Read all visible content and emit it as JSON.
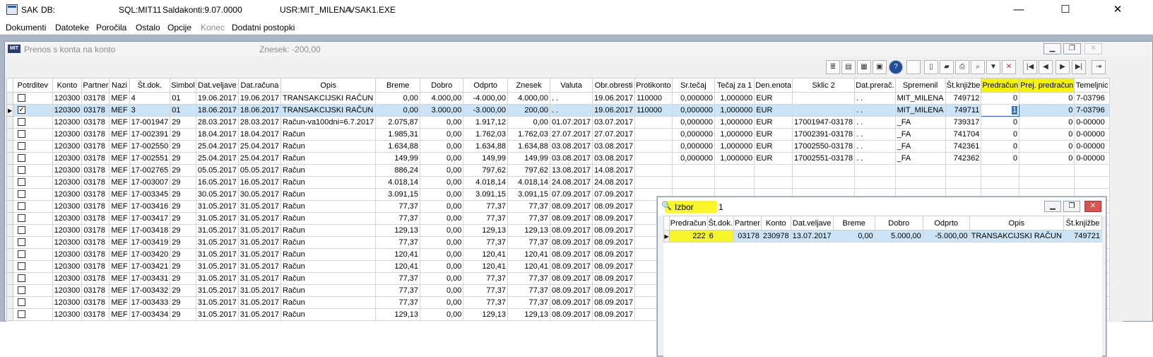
{
  "window": {
    "app": "SAK",
    "db_label": "DB:",
    "sql": "SQL:MIT11",
    "saldakonti": "Saldakonti:9.07.0000",
    "usr": "USR:MIT_MILENA",
    "exe": "VSAK1.EXE",
    "minimize": "—",
    "maximize": "☐",
    "close": "✕"
  },
  "menu": [
    "Dokumenti",
    "Datoteke",
    "Poročila",
    "Ostalo",
    "Opcije",
    "Konec",
    "Dodatni postopki"
  ],
  "child": {
    "logo": "MIT",
    "title": "Prenos s konta na konto",
    "znesek": "Znesek: -200,00"
  },
  "toolbar_icons": [
    "notes-icon",
    "folder-icon",
    "print-preview-icon",
    "monitor-icon",
    "help-icon",
    "blank-icon",
    "new-icon",
    "open-icon",
    "print-icon",
    "search-icon",
    "filter-icon",
    "delete-icon",
    "first-icon",
    "prev-icon",
    "next-icon",
    "last-icon",
    "exit-icon"
  ],
  "main_grid": {
    "columns": [
      "",
      "Potrditev",
      "Konto",
      "Partner",
      "Nazi",
      "Št.dok.",
      "Simbol",
      "Dat.veljave",
      "Dat.računa",
      "Opis",
      "Breme",
      "Dobro",
      "Odprto",
      "Znesek",
      "Valuta",
      "Obr.obresti",
      "Protikonto",
      "Sr.tečaj",
      "Tečaj za 1",
      "Den.enota",
      "Sklic 2",
      "Dat.prerač.",
      "Spremenil",
      "Št.knjižbe",
      "Predračun",
      "Prej. predračun",
      "Temeljnic"
    ],
    "rows": [
      {
        "ind": "",
        "chk": "",
        "c": [
          "120300",
          "03178",
          "MEF",
          "4",
          "01",
          "19.06.2017",
          "19.06.2017",
          "TRANSAKCIJSKI RAČUN",
          "0,00",
          "4.000,00",
          "-4.000,00",
          "4.000,00",
          ". .",
          "19.06.2017",
          "110000",
          "0,000000",
          "1,000000",
          "EUR",
          "",
          ". .",
          "MIT_MILENA",
          "749712",
          "0",
          "0",
          "7-03796"
        ]
      },
      {
        "ind": "▶",
        "chk": "✓",
        "c": [
          "120300",
          "03178",
          "MEF",
          "3",
          "01",
          "18.06.2017",
          "18.06.2017",
          "TRANSAKCIJSKI RAČUN",
          "0,00",
          "3.000,00",
          "-3.000,00",
          "200,00",
          ". .",
          "19.06.2017",
          "110000",
          "0,000000",
          "1,000000",
          "EUR",
          "",
          ". .",
          "MIT_MILENA",
          "749711",
          "1",
          "0",
          "7-03796"
        ]
      },
      {
        "ind": "",
        "chk": "",
        "c": [
          "120300",
          "03178",
          "MEF",
          "17-001947",
          "29",
          "28.03.2017",
          "28.03.2017",
          "Račun-va100dni=6.7.2017",
          "2.075,87",
          "0,00",
          "1.917,12",
          "0,00",
          "01.07.2017",
          "03.07.2017",
          "",
          "0,000000",
          "1,000000",
          "EUR",
          "17001947-03178",
          ". .",
          "_FA",
          "739317",
          "0",
          "0",
          "0-00000"
        ]
      },
      {
        "ind": "",
        "chk": "",
        "c": [
          "120300",
          "03178",
          "MEF",
          "17-002391",
          "29",
          "18.04.2017",
          "18.04.2017",
          "Račun",
          "1.985,31",
          "0,00",
          "1.762,03",
          "1.762,03",
          "27.07.2017",
          "27.07.2017",
          "",
          "0,000000",
          "1,000000",
          "EUR",
          "17002391-03178",
          ". .",
          "_FA",
          "741704",
          "0",
          "0",
          "0-00000"
        ]
      },
      {
        "ind": "",
        "chk": "",
        "c": [
          "120300",
          "03178",
          "MEF",
          "17-002550",
          "29",
          "25.04.2017",
          "25.04.2017",
          "Račun",
          "1.634,88",
          "0,00",
          "1.634,88",
          "1.634,88",
          "03.08.2017",
          "03.08.2017",
          "",
          "0,000000",
          "1,000000",
          "EUR",
          "17002550-03178",
          ". .",
          "_FA",
          "742361",
          "0",
          "0",
          "0-00000"
        ]
      },
      {
        "ind": "",
        "chk": "",
        "c": [
          "120300",
          "03178",
          "MEF",
          "17-002551",
          "29",
          "25.04.2017",
          "25.04.2017",
          "Račun",
          "149,99",
          "0,00",
          "149,99",
          "149,99",
          "03.08.2017",
          "03.08.2017",
          "",
          "0,000000",
          "1,000000",
          "EUR",
          "17002551-03178",
          ". .",
          "_FA",
          "742362",
          "0",
          "0",
          "0-00000"
        ]
      },
      {
        "ind": "",
        "chk": "",
        "c": [
          "120300",
          "03178",
          "MEF",
          "17-002765",
          "29",
          "05.05.2017",
          "05.05.2017",
          "Račun",
          "886,24",
          "0,00",
          "797,62",
          "797,62",
          "13.08.2017",
          "14.08.2017",
          "",
          "",
          "",
          "",
          "",
          "",
          "",
          "",
          "",
          "",
          ""
        ]
      },
      {
        "ind": "",
        "chk": "",
        "c": [
          "120300",
          "03178",
          "MEF",
          "17-003007",
          "29",
          "16.05.2017",
          "16.05.2017",
          "Račun",
          "4.018,14",
          "0,00",
          "4.018,14",
          "4.018,14",
          "24.08.2017",
          "24.08.2017",
          "",
          "",
          "",
          "",
          "",
          "",
          "",
          "",
          "",
          "",
          ""
        ]
      },
      {
        "ind": "",
        "chk": "",
        "c": [
          "120300",
          "03178",
          "MEF",
          "17-003345",
          "29",
          "30.05.2017",
          "30.05.2017",
          "Račun",
          "3.091,15",
          "0,00",
          "3.091,15",
          "3.091,15",
          "07.09.2017",
          "07.09.2017",
          "",
          "",
          "",
          "",
          "",
          "",
          "",
          "",
          "",
          "",
          ""
        ]
      },
      {
        "ind": "",
        "chk": "",
        "c": [
          "120300",
          "03178",
          "MEF",
          "17-003416",
          "29",
          "31.05.2017",
          "31.05.2017",
          "Račun",
          "77,37",
          "0,00",
          "77,37",
          "77,37",
          "08.09.2017",
          "08.09.2017",
          "",
          "",
          "",
          "",
          "",
          "",
          "",
          "",
          "",
          "",
          ""
        ]
      },
      {
        "ind": "",
        "chk": "",
        "c": [
          "120300",
          "03178",
          "MEF",
          "17-003417",
          "29",
          "31.05.2017",
          "31.05.2017",
          "Račun",
          "77,37",
          "0,00",
          "77,37",
          "77,37",
          "08.09.2017",
          "08.09.2017",
          "",
          "",
          "",
          "",
          "",
          "",
          "",
          "",
          "",
          "",
          ""
        ]
      },
      {
        "ind": "",
        "chk": "",
        "c": [
          "120300",
          "03178",
          "MEF",
          "17-003418",
          "29",
          "31.05.2017",
          "31.05.2017",
          "Račun",
          "129,13",
          "0,00",
          "129,13",
          "129,13",
          "08.09.2017",
          "08.09.2017",
          "",
          "",
          "",
          "",
          "",
          "",
          "",
          "",
          "",
          "",
          ""
        ]
      },
      {
        "ind": "",
        "chk": "",
        "c": [
          "120300",
          "03178",
          "MEF",
          "17-003419",
          "29",
          "31.05.2017",
          "31.05.2017",
          "Račun",
          "77,37",
          "0,00",
          "77,37",
          "77,37",
          "08.09.2017",
          "08.09.2017",
          "",
          "",
          "",
          "",
          "",
          "",
          "",
          "",
          "",
          "",
          ""
        ]
      },
      {
        "ind": "",
        "chk": "",
        "c": [
          "120300",
          "03178",
          "MEF",
          "17-003420",
          "29",
          "31.05.2017",
          "31.05.2017",
          "Račun",
          "120,41",
          "0,00",
          "120,41",
          "120,41",
          "08.09.2017",
          "08.09.2017",
          "",
          "",
          "",
          "",
          "",
          "",
          "",
          "",
          "",
          "",
          ""
        ]
      },
      {
        "ind": "",
        "chk": "",
        "c": [
          "120300",
          "03178",
          "MEF",
          "17-003421",
          "29",
          "31.05.2017",
          "31.05.2017",
          "Račun",
          "120,41",
          "0,00",
          "120,41",
          "120,41",
          "08.09.2017",
          "08.09.2017",
          "",
          "",
          "",
          "",
          "",
          "",
          "",
          "",
          "",
          "",
          ""
        ]
      },
      {
        "ind": "",
        "chk": "",
        "c": [
          "120300",
          "03178",
          "MEF",
          "17-003431",
          "29",
          "31.05.2017",
          "31.05.2017",
          "Račun",
          "77,37",
          "0,00",
          "77,37",
          "77,37",
          "08.09.2017",
          "08.09.2017",
          "",
          "",
          "",
          "",
          "",
          "",
          "",
          "",
          "",
          "",
          ""
        ]
      },
      {
        "ind": "",
        "chk": "",
        "c": [
          "120300",
          "03178",
          "MEF",
          "17-003432",
          "29",
          "31.05.2017",
          "31.05.2017",
          "Račun",
          "77,37",
          "0,00",
          "77,37",
          "77,37",
          "08.09.2017",
          "08.09.2017",
          "",
          "",
          "",
          "",
          "",
          "",
          "",
          "",
          "",
          "",
          ""
        ]
      },
      {
        "ind": "",
        "chk": "",
        "c": [
          "120300",
          "03178",
          "MEF",
          "17-003433",
          "29",
          "31.05.2017",
          "31.05.2017",
          "Račun",
          "77,37",
          "0,00",
          "77,37",
          "77,37",
          "08.09.2017",
          "08.09.2017",
          "",
          "",
          "",
          "",
          "",
          "",
          "",
          "",
          "",
          "",
          ""
        ]
      },
      {
        "ind": "",
        "chk": "",
        "c": [
          "120300",
          "03178",
          "MEF",
          "17-003434",
          "29",
          "31.05.2017",
          "31.05.2017",
          "Račun",
          "129,13",
          "0,00",
          "129,13",
          "129,13",
          "08.09.2017",
          "08.09.2017",
          "",
          "",
          "",
          "",
          "",
          "",
          "",
          "",
          "",
          "",
          ""
        ]
      }
    ]
  },
  "izbor": {
    "title": "Izbor",
    "count": "1",
    "columns": [
      "",
      "Predračun",
      "Št.dok.",
      "Partner",
      "Konto",
      "Dat.veljave",
      "Breme",
      "Dobro",
      "Odprto",
      "Opis",
      "Št.knjižbe"
    ],
    "rows": [
      {
        "ind": "▶",
        "c": [
          "222",
          "6",
          "03178",
          "230978",
          "13.07.2017",
          "0,00",
          "5.000,00",
          "-5.000,00",
          "TRANSAKCIJSKI RAČUN",
          "749721"
        ]
      }
    ]
  }
}
